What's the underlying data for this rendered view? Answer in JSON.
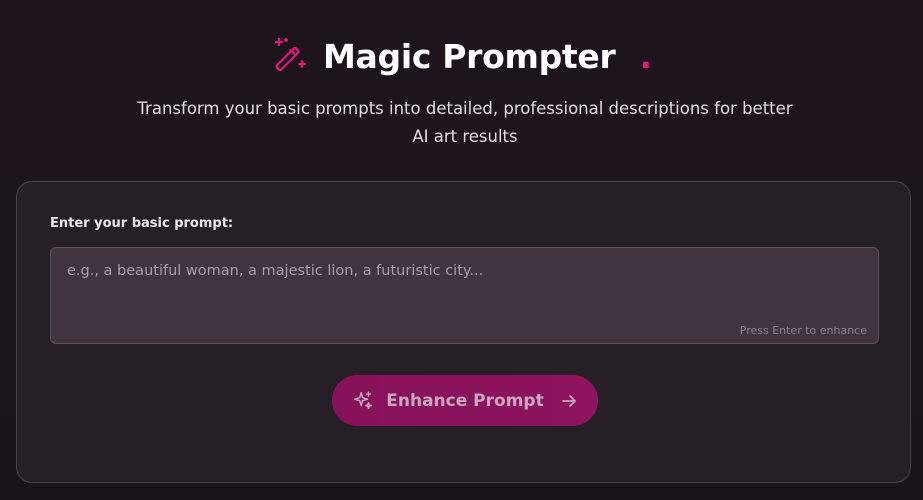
{
  "header": {
    "title": "Magic Prompter",
    "title_dot": ".",
    "icon": "magic-wand-icon",
    "subtitle": "Transform your basic prompts into detailed, professional descriptions for better AI art results"
  },
  "form": {
    "label": "Enter your basic prompt:",
    "prompt_value": "",
    "prompt_placeholder": "e.g., a beautiful woman, a majestic lion, a futuristic city...",
    "hint": "Press Enter to enhance"
  },
  "enhance_button": {
    "label": "Enhance Prompt",
    "left_icon": "sparkles-icon",
    "right_icon": "arrow-right-icon"
  },
  "colors": {
    "accent": "#e0197a",
    "button_bg": "#8a135d",
    "background": "#1c141c",
    "card_bg": "#271f28",
    "input_bg": "#3f3440"
  }
}
